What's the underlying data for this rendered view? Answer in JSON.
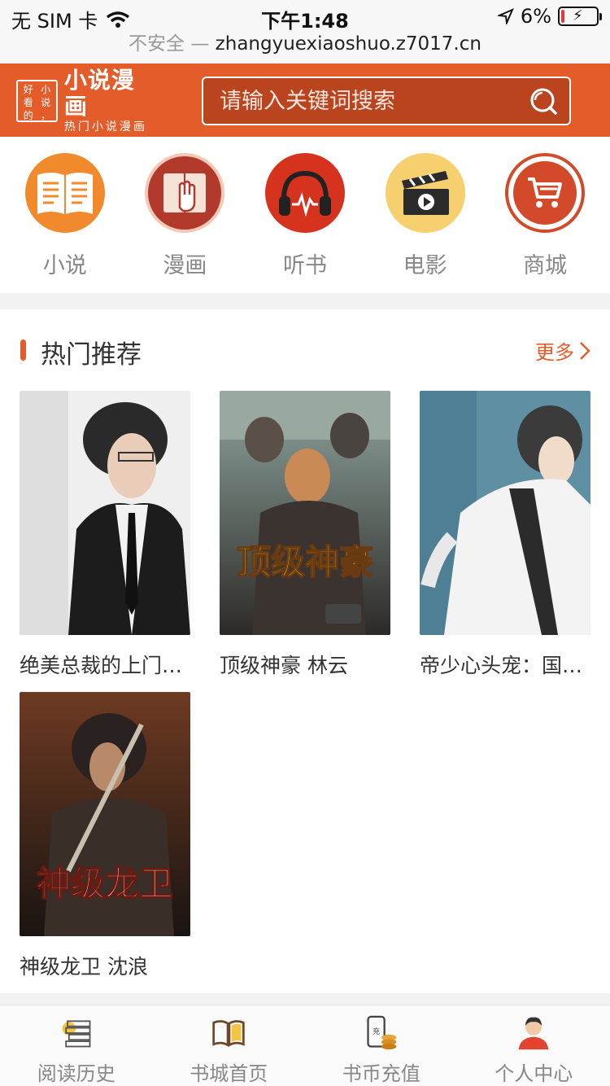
{
  "status_bar": {
    "carrier": "无 SIM 卡",
    "time": "下午1:48",
    "battery": "6%",
    "battery_level": 0.06
  },
  "url_bar": {
    "security": "不安全",
    "separator": "—",
    "domain": "zhangyuexiaoshuo.z7017.cn"
  },
  "header": {
    "logo": {
      "box_chars": [
        "好",
        "小",
        "看",
        "说",
        "的",
        "，"
      ],
      "title": "小说漫画",
      "subtitle": "热门小说漫画"
    },
    "search_placeholder": "请输入关键词搜索",
    "brand_color": "#e55c2b"
  },
  "categories": [
    {
      "label": "小说",
      "icon": "open-book-icon"
    },
    {
      "label": "漫画",
      "icon": "comic-hand-icon"
    },
    {
      "label": "听书",
      "icon": "headphones-icon"
    },
    {
      "label": "电影",
      "icon": "clapperboard-icon"
    },
    {
      "label": "商城",
      "icon": "shopping-cart-icon"
    }
  ],
  "hot": {
    "title": "热门推荐",
    "more": "更多",
    "books": [
      {
        "title": "绝美总裁的上门…"
      },
      {
        "title": "顶级神豪 林云",
        "cover_text": "顶级神豪"
      },
      {
        "title": "帝少心头宠：国…"
      },
      {
        "title": "神级龙卫 沈浪",
        "cover_text": "神级龙卫"
      }
    ]
  },
  "bottom_nav": [
    {
      "label": "阅读历史",
      "icon": "history-books-icon"
    },
    {
      "label": "书城首页",
      "icon": "open-book-icon"
    },
    {
      "label": "书币充值",
      "icon": "phone-coins-icon"
    },
    {
      "label": "个人中心",
      "icon": "user-avatar-icon"
    }
  ]
}
